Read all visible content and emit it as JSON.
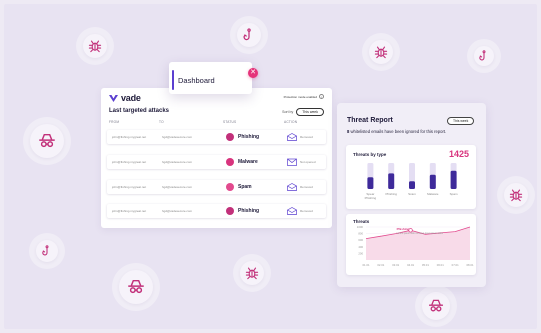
{
  "colors": {
    "background": "#e8e3f2",
    "brand": "#5b3fd0",
    "accent": "#d8347e",
    "phishing": "#c2307a",
    "malware": "#d8347e",
    "spam": "#e24a8e"
  },
  "floating_icons": [
    {
      "name": "bug-icon"
    },
    {
      "name": "hook-icon"
    },
    {
      "name": "bug-icon"
    },
    {
      "name": "hook-icon"
    },
    {
      "name": "spy-icon"
    },
    {
      "name": "bug-icon"
    },
    {
      "name": "hook-icon"
    },
    {
      "name": "spy-icon"
    },
    {
      "name": "bug-icon"
    },
    {
      "name": "spy-icon"
    }
  ],
  "app": {
    "logo": "vade",
    "protection_mode": "Protection mode enabled",
    "info_icon": "info-icon"
  },
  "dashboard_tab": {
    "title": "Dashboard",
    "close_icon": "close-icon"
  },
  "attacks": {
    "title": "Last targeted attacks",
    "sort_label": "Sort by",
    "sort_value": "This week",
    "columns": [
      "FROM",
      "TO",
      "STATUS",
      "ACTION"
    ],
    "rows": [
      {
        "from": "john@fishing.mygreat.net",
        "to": "hgd@vadesecure.com",
        "status": "Phishing",
        "status_icon": "hook-icon",
        "action": "Removed",
        "action_icon": "trash-mail-icon"
      },
      {
        "from": "john@fishing.mygreat.net",
        "to": "hgd@vadesecure.com",
        "status": "Malware",
        "status_icon": "bug-icon",
        "action": "Not opened",
        "action_icon": "envelope-icon"
      },
      {
        "from": "john@fishing.mygreat.net",
        "to": "hgd@vadesecure.com",
        "status": "Spam",
        "status_icon": "spam-icon",
        "action": "Removed",
        "action_icon": "trash-mail-icon"
      },
      {
        "from": "john@fishing.mygreat.net",
        "to": "hgd@vadesecure.com",
        "status": "Phishing",
        "status_icon": "hook-icon",
        "action": "Removed",
        "action_icon": "trash-mail-icon"
      }
    ]
  },
  "report": {
    "title": "Threat Report",
    "period": "This week",
    "ignored_count": "8",
    "ignored_text": "whitelisted emails have been ignored for this report.",
    "by_type_title": "Threats by type",
    "total": "1425",
    "threats_title": "Threats"
  },
  "chart_data": [
    {
      "type": "bar",
      "title": "Threats by type",
      "categories": [
        "Spear Phishing",
        "Phishing",
        "Scam",
        "Malware",
        "Spam"
      ],
      "values": [
        0.45,
        0.6,
        0.3,
        0.55,
        0.7
      ]
    },
    {
      "type": "area",
      "title": "Threats",
      "x": [
        "01.01",
        "02.01",
        "03.01",
        "04.01",
        "05.01",
        "06.01",
        "07.01",
        "08.01"
      ],
      "values": [
        650,
        720,
        800,
        900,
        780,
        820,
        860,
        1000
      ],
      "ylim": [
        0,
        1000
      ],
      "y_ticks": [
        "1000",
        "800",
        "600",
        "400",
        "200"
      ],
      "tooltip": {
        "title": "Phishing",
        "text": "Lorem ipsum dolor sit amet lorem ipsum dolor"
      }
    }
  ]
}
